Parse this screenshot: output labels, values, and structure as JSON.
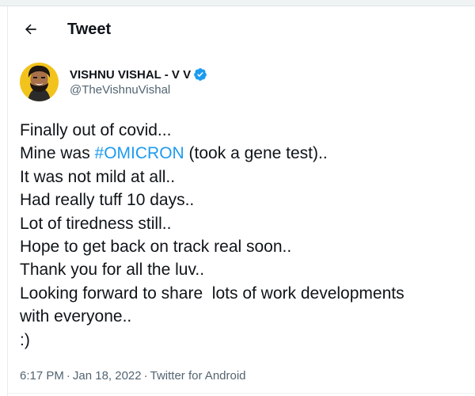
{
  "header": {
    "back_icon": "arrow-left-icon",
    "title": "Tweet"
  },
  "author": {
    "display_name": "VISHNU VISHAL - V V",
    "handle": "@TheVishnuVishal",
    "verified": true,
    "verified_icon": "verified-badge-icon",
    "avatar_icon": "profile-avatar"
  },
  "tweet": {
    "lines": [
      {
        "before": "Finally out of covid..."
      },
      {
        "before": "Mine was ",
        "hashtag": "#OMICRON",
        "after": " (took a gene test).."
      },
      {
        "before": "It was not mild at all.."
      },
      {
        "before": "Had really tuff 10 days.."
      },
      {
        "before": "Lot of tiredness still.."
      },
      {
        "before": "Hope to get back on track real soon.."
      },
      {
        "before": "Thank you for all the luv.."
      },
      {
        "before": "Looking forward to share  lots of work developments"
      },
      {
        "before": "with everyone.."
      },
      {
        "before": ":)"
      }
    ]
  },
  "meta": {
    "time": "6:17 PM",
    "separator": "·",
    "date": "Jan 18, 2022",
    "source": "Twitter for Android"
  },
  "colors": {
    "text": "#0f1419",
    "secondary": "#536471",
    "link": "#1d9bf0",
    "avatar_bg": "#f2c31d"
  }
}
